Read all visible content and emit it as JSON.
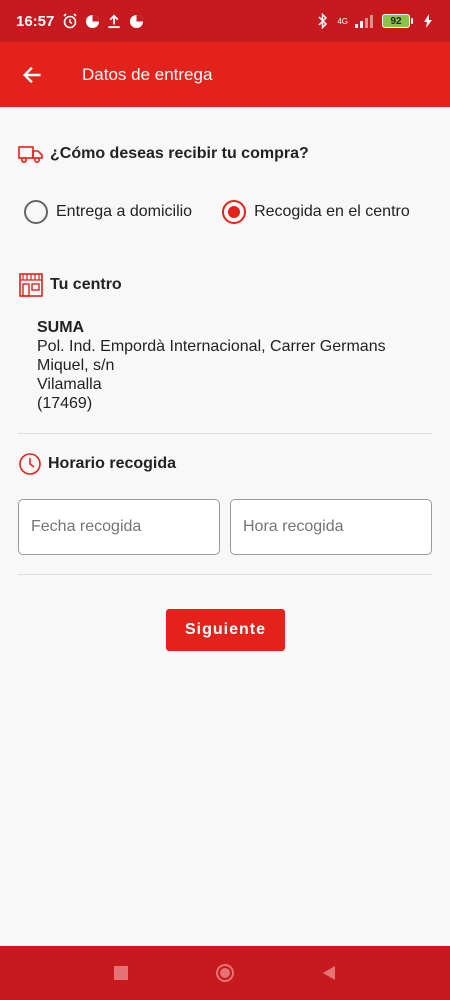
{
  "status_bar": {
    "time": "16:57",
    "network": "4G",
    "battery": "92"
  },
  "app_bar": {
    "title": "Datos de entrega"
  },
  "delivery": {
    "question": "¿Cómo deseas recibir tu compra?",
    "options": [
      {
        "label": "Entrega a domicilio",
        "selected": false
      },
      {
        "label": "Recogida en el centro",
        "selected": true
      }
    ]
  },
  "center": {
    "heading": "Tu centro",
    "name": "SUMA",
    "address_line1": "Pol. Ind. Empordà Internacional, Carrer Germans",
    "address_line2": "Miquel, s/n",
    "city": "Vilamalla",
    "postal_code": "(17469)"
  },
  "pickup": {
    "heading": "Horario recogida",
    "date_placeholder": "Fecha recogida",
    "time_placeholder": "Hora recogida"
  },
  "actions": {
    "next_label": "Siguiente"
  },
  "colors": {
    "primary": "#e3221b",
    "status_bar": "#c71a1e"
  }
}
